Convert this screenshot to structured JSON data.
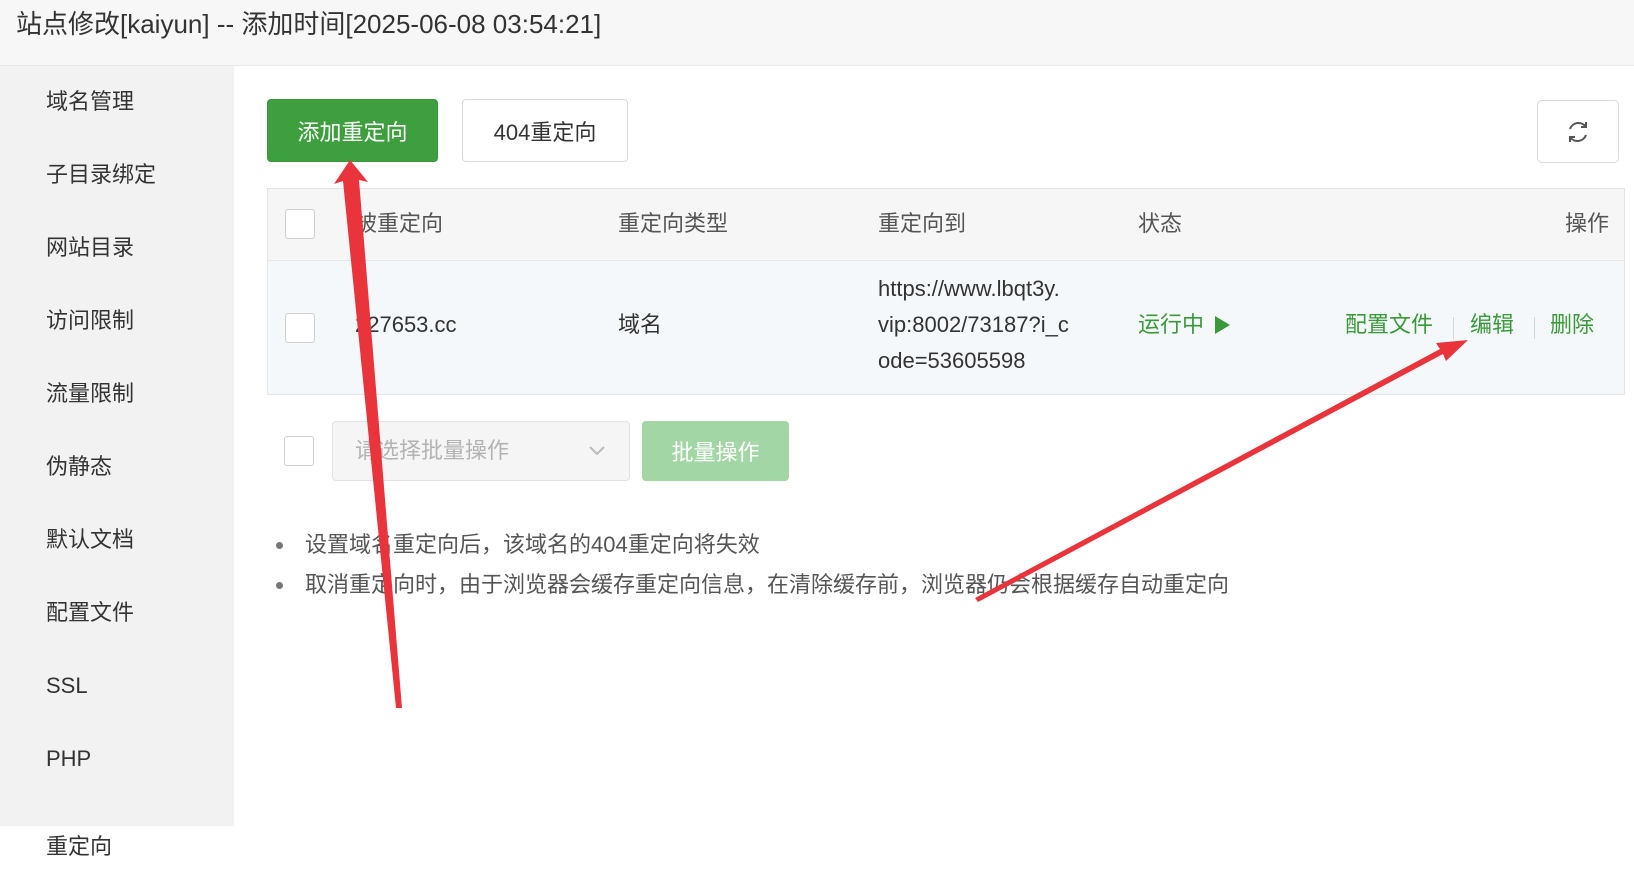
{
  "window": {
    "title": "站点修改[kaiyun] -- 添加时间[2025-06-08 03:54:21]"
  },
  "sidebar": {
    "items": [
      {
        "label": "域名管理"
      },
      {
        "label": "子目录绑定"
      },
      {
        "label": "网站目录"
      },
      {
        "label": "访问限制"
      },
      {
        "label": "流量限制"
      },
      {
        "label": "伪静态"
      },
      {
        "label": "默认文档"
      },
      {
        "label": "配置文件"
      },
      {
        "label": "SSL"
      },
      {
        "label": "PHP"
      },
      {
        "label": "重定向"
      }
    ],
    "active": "重定向"
  },
  "toolbar": {
    "add_label": "添加重定向",
    "redirect404_label": "404重定向",
    "refresh_icon": "refresh-icon"
  },
  "table": {
    "headers": {
      "source": "被重定向",
      "type": "重定向类型",
      "target": "重定向到",
      "status": "状态",
      "actions": "操作"
    },
    "rows": [
      {
        "source": "227653.cc",
        "type": "域名",
        "target_lines": [
          "https://www.lbqt3y.",
          "vip:8002/73187?i_c",
          "ode=53605598"
        ],
        "status": "运行中",
        "status_icon": "play-icon",
        "actions": {
          "config": "配置文件",
          "edit": "编辑",
          "delete": "删除"
        }
      }
    ]
  },
  "batch": {
    "placeholder": "请选择批量操作",
    "button_label": "批量操作"
  },
  "notes": [
    "设置域名重定向后，该域名的404重定向将失效",
    "取消重定向时，由于浏览器会缓存重定向信息，在清除缓存前，浏览器仍会根据缓存自动重定向"
  ],
  "colors": {
    "primary": "#3e9f3e",
    "primary_disabled": "#a3d6a5",
    "link_green": "#3a9a3a",
    "annotation_red": "#e8343a"
  }
}
